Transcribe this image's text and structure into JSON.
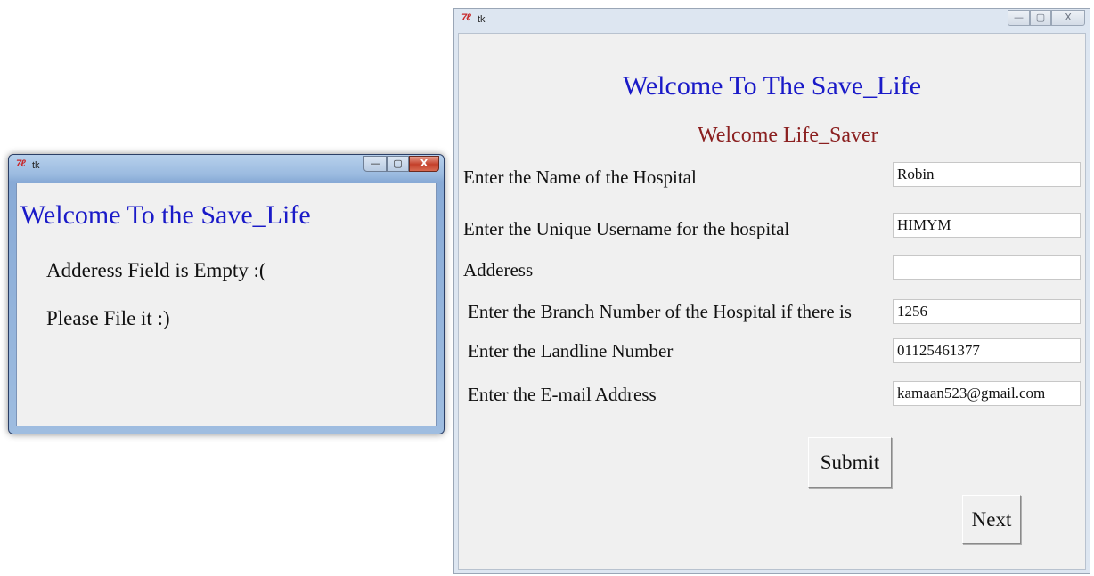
{
  "popup": {
    "window_title": "tk",
    "title": "Welcome To the Save_Life",
    "message_line1": "Adderess Field is Empty :(",
    "message_line2": "Please File it :)",
    "controls": {
      "minimize": "—",
      "maximize": "▢",
      "close": "X"
    }
  },
  "main": {
    "window_title": "tk",
    "title": "Welcome To The Save_Life",
    "subtitle": "Welcome Life_Saver",
    "controls": {
      "minimize": "—",
      "maximize": "▢",
      "close": "X"
    },
    "fields": [
      {
        "label": "Enter the Name of the Hospital",
        "value": "Robin"
      },
      {
        "label": "Enter the Unique Username for the hospital",
        "value": "HIMYM"
      },
      {
        "label": "Adderess",
        "value": ""
      },
      {
        "label": "Enter the Branch Number of the Hospital if there is",
        "value": "1256"
      },
      {
        "label": "Enter the Landline Number",
        "value": "01125461377"
      },
      {
        "label": "Enter the E-mail Address",
        "value": "kamaan523@gmail.com"
      }
    ],
    "submit_label": "Submit",
    "next_label": "Next"
  },
  "colors": {
    "title_blue": "#1a1ac8",
    "subtitle_red": "#8b2020",
    "client_bg": "#f0f0f0"
  },
  "icons": [
    "tk-feather-icon",
    "minimize-icon",
    "maximize-icon",
    "close-icon"
  ]
}
